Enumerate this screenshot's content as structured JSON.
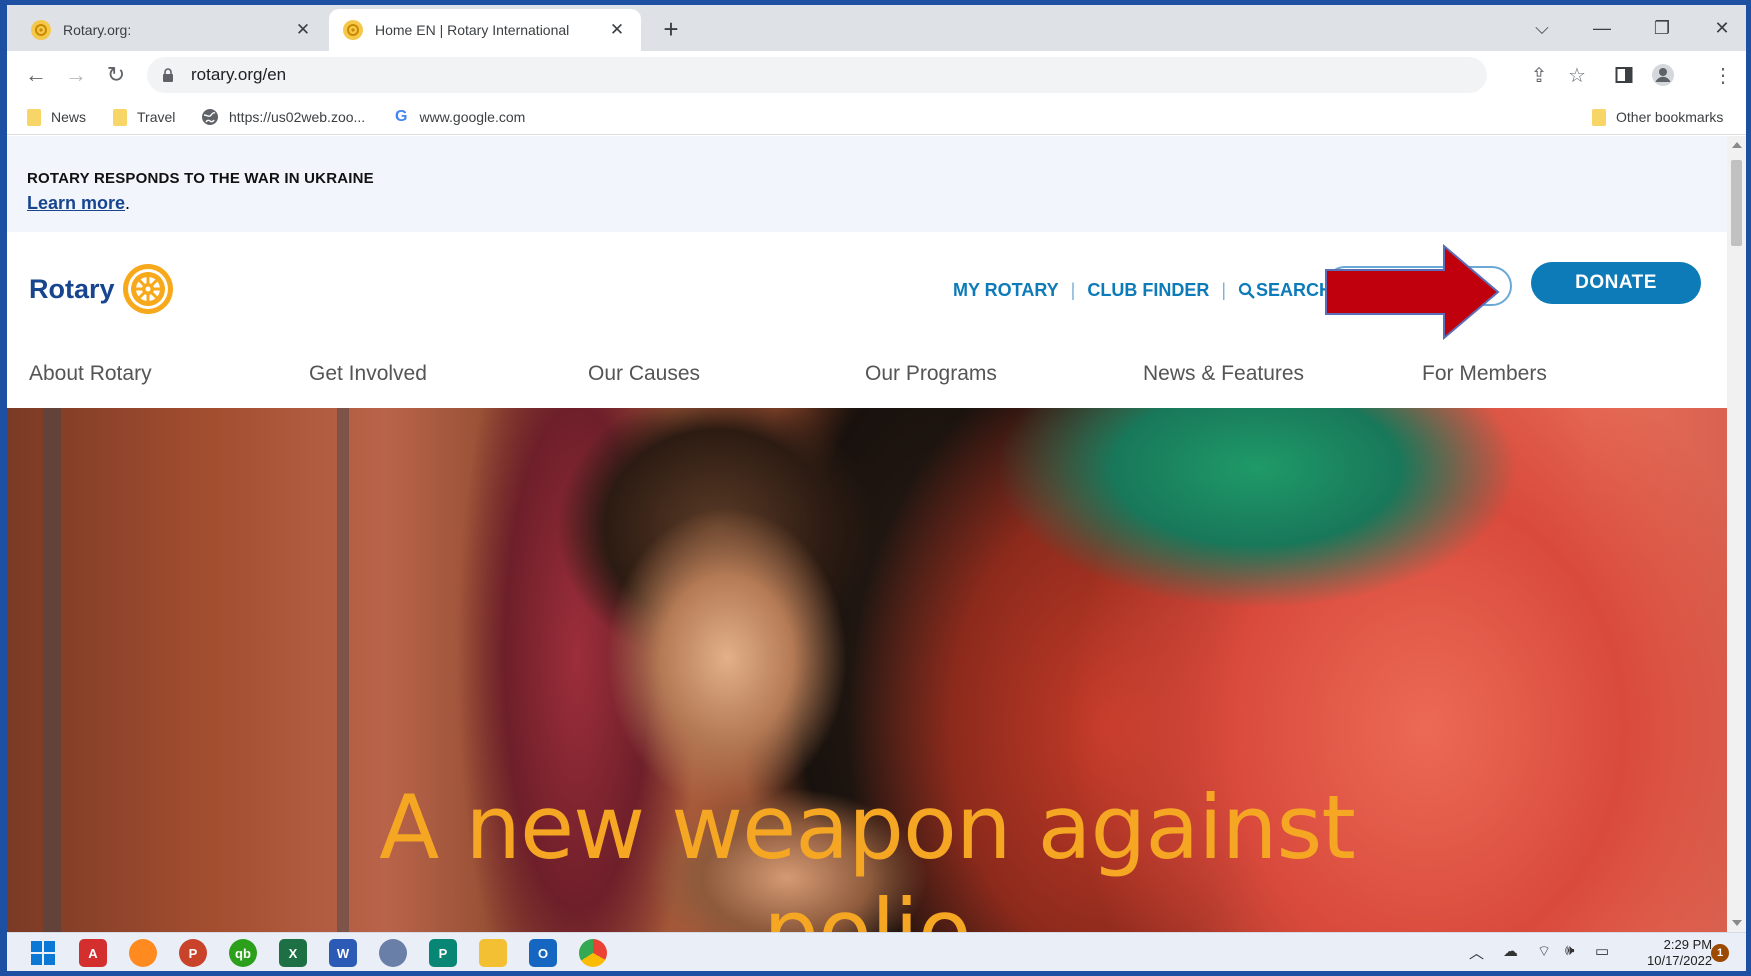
{
  "browser": {
    "tabs": [
      {
        "title": "Rotary.org:",
        "active": false
      },
      {
        "title": "Home EN | Rotary International",
        "active": true
      }
    ],
    "new_tab": "+",
    "window_controls": {
      "tab_search": "⌵",
      "minimize": "—",
      "restore": "❐",
      "close": "✕"
    },
    "address": "rotary.org/en",
    "bookmarks": [
      {
        "label": "News",
        "icon": "folder-icon"
      },
      {
        "label": "Travel",
        "icon": "folder-icon"
      },
      {
        "label": "https://us02web.zoo...",
        "icon": "globe-icon"
      },
      {
        "label": "www.google.com",
        "icon": "google-icon"
      }
    ],
    "other_bookmarks": "Other bookmarks"
  },
  "page": {
    "alert": {
      "heading": "ROTARY RESPONDS TO THE WAR IN UKRAINE",
      "link": "Learn more",
      "link_suffix": "."
    },
    "logo_text": "Rotary",
    "utility_nav": {
      "my_rotary": "MY ROTARY",
      "club_finder": "CLUB FINDER",
      "search": "SEARCH",
      "separator": "|"
    },
    "donate": "DONATE",
    "main_nav": [
      "About Rotary",
      "Get Involved",
      "Our Causes",
      "Our Programs",
      "News & Features",
      "For Members"
    ],
    "hero": {
      "title_line1": "A new weapon against",
      "title_line2": "polio"
    }
  },
  "taskbar": {
    "apps": [
      "windows-start",
      "acrobat",
      "firefox",
      "powerpoint",
      "quickbooks",
      "excel",
      "word",
      "photo-viewer",
      "publisher",
      "file-explorer",
      "outlook",
      "chrome"
    ],
    "time": "2:29 PM",
    "date": "10/17/2022",
    "notifications": "1"
  },
  "colors": {
    "rotary_blue": "#17458f",
    "rotary_azure": "#0c7bb8",
    "rotary_gold": "#f5a623",
    "annotation_arrow": "#c0000c"
  }
}
